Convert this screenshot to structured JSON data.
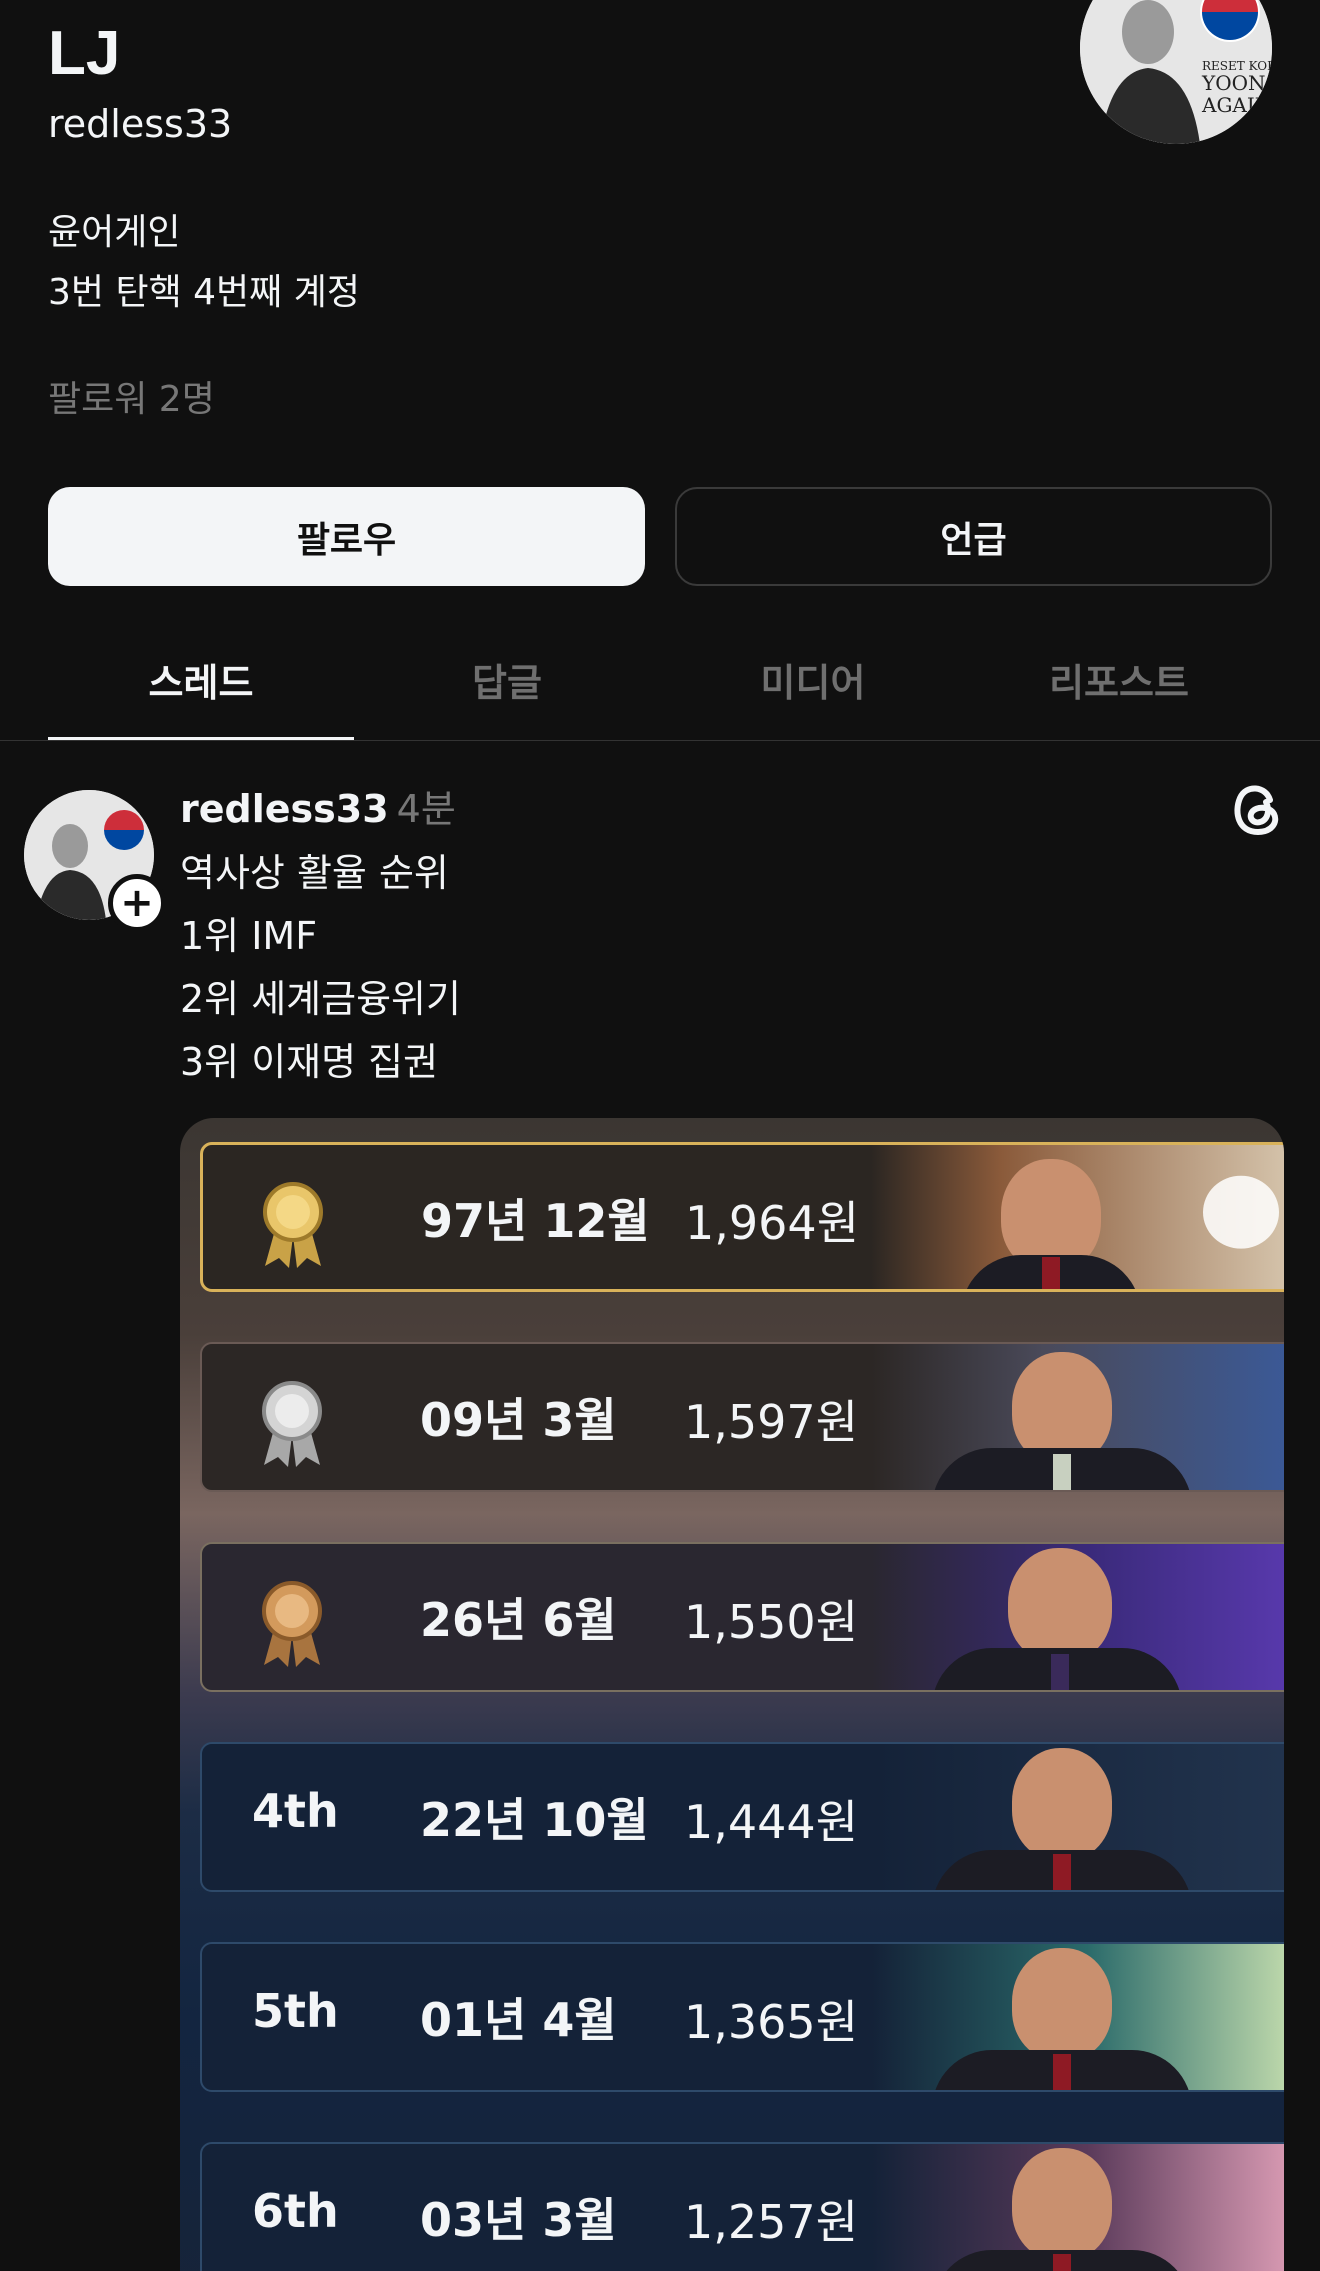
{
  "profile": {
    "name": "LJ",
    "handle": "redless33",
    "bio": [
      "윤어게인",
      "3번 탄핵 4번째 계정"
    ],
    "followers": "팔로워 2명",
    "avatar_text": [
      "RESET KOREA",
      "YOON",
      "AGAIN"
    ]
  },
  "actions": {
    "follow_label": "팔로우",
    "mention_label": "언급"
  },
  "tabs": [
    {
      "label": "스레드",
      "active": true
    },
    {
      "label": "답글",
      "active": false
    },
    {
      "label": "미디어",
      "active": false
    },
    {
      "label": "리포스트",
      "active": false
    }
  ],
  "post": {
    "author": "redless33",
    "time": "4분",
    "lines": [
      "역사상 활율 순위",
      "1위 IMF",
      "2위 세계금융위기",
      "3위 이재명 집권"
    ],
    "image": {
      "rows": [
        {
          "rank": "1",
          "medal": "gold",
          "date": "97년 12월",
          "value": "1,964원"
        },
        {
          "rank": "2",
          "medal": "silver",
          "date": "09년 3월",
          "value": "1,597원"
        },
        {
          "rank": "3",
          "medal": "bronze",
          "date": "26년 6월",
          "value": "1,550원"
        },
        {
          "rank": "4th",
          "medal": "",
          "date": "22년 10월",
          "value": "1,444원"
        },
        {
          "rank": "5th",
          "medal": "",
          "date": "01년 4월",
          "value": "1,365원"
        },
        {
          "rank": "6th",
          "medal": "",
          "date": "03년 3월",
          "value": "1,257원"
        }
      ]
    }
  },
  "colors": {
    "background": "#101010",
    "text": "#f3f5f7",
    "muted": "#777777",
    "gold": "#d9b25a",
    "silver": "#c8c8c8",
    "bronze": "#c98b4f"
  }
}
